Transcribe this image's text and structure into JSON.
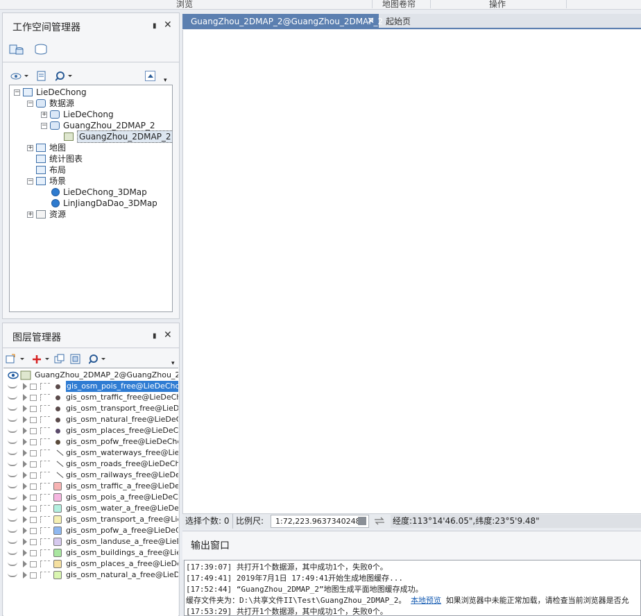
{
  "ribbon": {
    "tab1": "浏览",
    "tab2": "地图卷帘",
    "tab3": "操作"
  },
  "workspace_panel": {
    "title": "工作空间管理器",
    "tree": [
      {
        "label": "LieDeChong",
        "level": 0,
        "icon": "workspace-icon",
        "expander": "−"
      },
      {
        "label": "数据源",
        "level": 1,
        "icon": "datasource-folder-icon",
        "expander": "−"
      },
      {
        "label": "LieDeChong",
        "level": 2,
        "icon": "udb-datasource-icon",
        "expander": "+"
      },
      {
        "label": "GuangZhou_2DMAP_2",
        "level": 2,
        "icon": "udb-datasource-icon",
        "expander": "−"
      },
      {
        "label": "GuangZhou_2DMAP_2",
        "level": 3,
        "icon": "dataset-icon",
        "expander": "",
        "selected": true
      },
      {
        "label": "地图",
        "level": 1,
        "icon": "map-folder-icon",
        "expander": "+"
      },
      {
        "label": "统计图表",
        "level": 1,
        "icon": "chart-folder-icon",
        "expander": ""
      },
      {
        "label": "布局",
        "level": 1,
        "icon": "layout-folder-icon",
        "expander": ""
      },
      {
        "label": "场景",
        "level": 1,
        "icon": "scene-folder-icon",
        "expander": "−"
      },
      {
        "label": "LieDeChong_3DMap",
        "level": 2,
        "icon": "globe-icon",
        "expander": ""
      },
      {
        "label": "LinJiangDaDao_3DMap",
        "level": 2,
        "icon": "globe-icon",
        "expander": ""
      },
      {
        "label": "资源",
        "level": 1,
        "icon": "resource-folder-icon",
        "expander": "+"
      }
    ]
  },
  "layer_panel": {
    "title": "图层管理器",
    "root_label": "GuangZhou_2DMAP_2@GuangZhou_2DM",
    "layers": [
      {
        "name": "gis_osm_pois_free@LieDeCho",
        "symbol": "point",
        "color": "#5a4a4a",
        "selected": true
      },
      {
        "name": "gis_osm_traffic_free@LieDeCh",
        "symbol": "point",
        "color": "#5a4a4a"
      },
      {
        "name": "gis_osm_transport_free@LieD",
        "symbol": "point",
        "color": "#5a4a4a"
      },
      {
        "name": "gis_osm_natural_free@LieDeC",
        "symbol": "point",
        "color": "#5a4a4a"
      },
      {
        "name": "gis_osm_places_free@LieDeCh",
        "symbol": "point",
        "color": "#5a4a6a"
      },
      {
        "name": "gis_osm_pofw_free@LieDeChc",
        "symbol": "point",
        "color": "#5a4a3a"
      },
      {
        "name": "gis_osm_waterways_free@LieD",
        "symbol": "line",
        "color": "#555555"
      },
      {
        "name": "gis_osm_roads_free@LieDeCh",
        "symbol": "line",
        "color": "#555555"
      },
      {
        "name": "gis_osm_railways_free@LieDe",
        "symbol": "line",
        "color": "#555555"
      },
      {
        "name": "gis_osm_traffic_a_free@LieDe",
        "symbol": "region",
        "color": "#f7b3b3"
      },
      {
        "name": "gis_osm_pois_a_free@LieDeC",
        "symbol": "region",
        "color": "#f5b6e0"
      },
      {
        "name": "gis_osm_water_a_free@LieDe",
        "symbol": "region",
        "color": "#b3f0e0"
      },
      {
        "name": "gis_osm_transport_a_free@Lie",
        "symbol": "region",
        "color": "#f5f0b3"
      },
      {
        "name": "gis_osm_pofw_a_free@LieDeC",
        "symbol": "region",
        "color": "#8fb8f0"
      },
      {
        "name": "gis_osm_landuse_a_free@LieD",
        "symbol": "region",
        "color": "#d6c9ee"
      },
      {
        "name": "gis_osm_buildings_a_free@Lie",
        "symbol": "region",
        "color": "#a9e6a0"
      },
      {
        "name": "gis_osm_places_a_free@LieDe",
        "symbol": "region",
        "color": "#f5e0a0"
      },
      {
        "name": "gis_osm_natural_a_free@LieDe",
        "symbol": "region",
        "color": "#d9f5b0"
      }
    ]
  },
  "doc_tabs": {
    "active": "GuangZhou_2DMAP_2@GuangZhou_2DMAP_2",
    "other": "起始页"
  },
  "status": {
    "selected_label": "选择个数: 0",
    "scale_label": "比例尺:",
    "scale_value": "1:72,223.9637340248",
    "coords": "经度:113°14'46.05\",纬度:23°5'9.48\""
  },
  "output": {
    "title": "输出窗口",
    "lines": [
      "[17:39:07] 共打开1个数据源，其中成功1个，失败0个。",
      "[17:49:41] 2019年7月1日 17:49:41开始生成地图缓存...",
      "[17:52:44] “GuangZhou_2DMAP_2”地图生成平面地图缓存成功。",
      "缓存文件夹为：D:\\共享文件II\\Test\\GuangZhou_2DMAP_2。",
      "[17:53:29] 共打开1个数据源，其中成功1个，失败0个。"
    ],
    "link_text": "本地预览",
    "line4_suffix": "如果浏览器中未能正常加载，请检查当前浏览器是否允"
  }
}
